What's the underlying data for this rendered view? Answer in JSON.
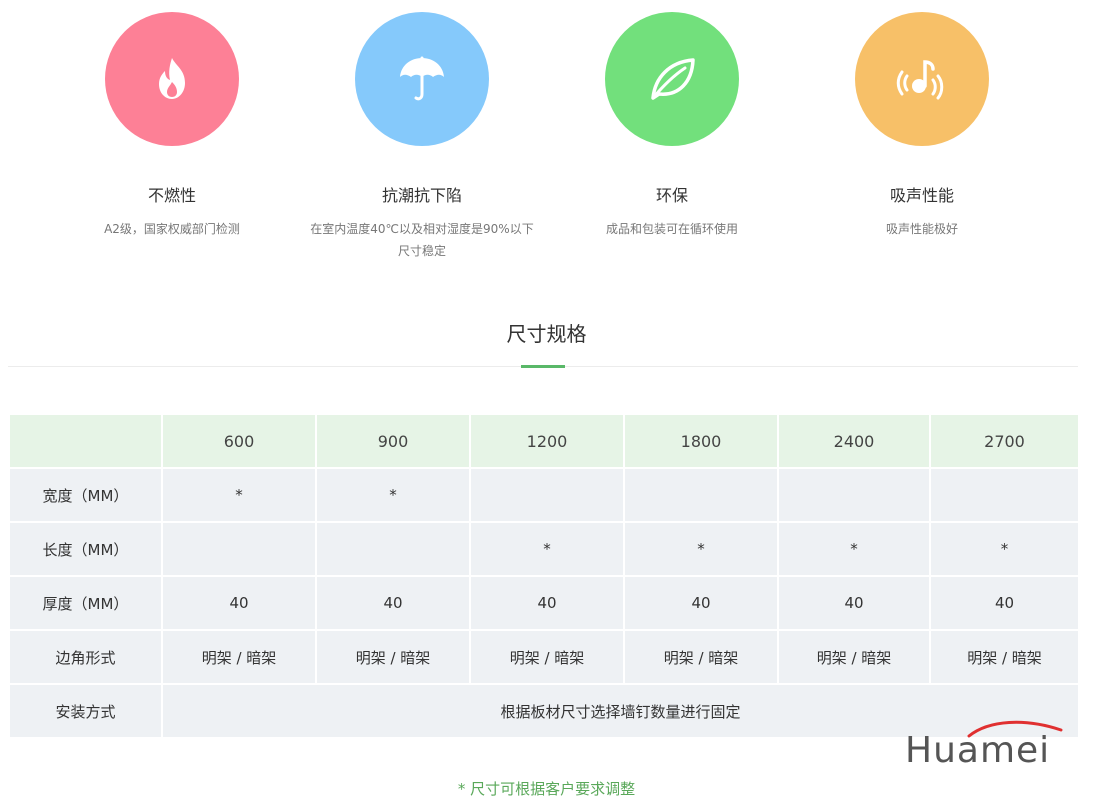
{
  "features": [
    {
      "title": "不燃性",
      "desc": [
        "A2级，国家权威部门检测"
      ],
      "color": "#fd8096",
      "icon": "fire-icon"
    },
    {
      "title": "抗潮抗下陷",
      "desc": [
        "在室内温度40℃以及相对湿度是90%以下",
        "尺寸稳定"
      ],
      "color": "#85c9fb",
      "icon": "umbrella-icon"
    },
    {
      "title": "环保",
      "desc": [
        "成品和包装可在循环使用"
      ],
      "color": "#72e07c",
      "icon": "leaf-icon"
    },
    {
      "title": "吸声性能",
      "desc": [
        "吸声性能极好"
      ],
      "color": "#f7c068",
      "icon": "music-note-icon"
    }
  ],
  "section_title": "尺寸规格",
  "table": {
    "header": [
      "",
      "600",
      "900",
      "1200",
      "1800",
      "2400",
      "2700"
    ],
    "rows": [
      {
        "label": "宽度（MM）",
        "cells": [
          "*",
          "*",
          "",
          "",
          "",
          ""
        ]
      },
      {
        "label": "长度（MM）",
        "cells": [
          "",
          "",
          "*",
          "*",
          "*",
          "*"
        ]
      },
      {
        "label": "厚度（MM）",
        "cells": [
          "40",
          "40",
          "40",
          "40",
          "40",
          "40"
        ]
      },
      {
        "label": "边角形式",
        "cells": [
          "明架 / 暗架",
          "明架 / 暗架",
          "明架 / 暗架",
          "明架 / 暗架",
          "明架 / 暗架",
          "明架 / 暗架"
        ]
      }
    ],
    "install": {
      "label": "安装方式",
      "value": "根据板材尺寸选择墙钉数量进行固定"
    }
  },
  "footnote": "* 尺寸可根据客户要求调整",
  "logo": {
    "text": "Huamei",
    "accent": "#e03030"
  }
}
